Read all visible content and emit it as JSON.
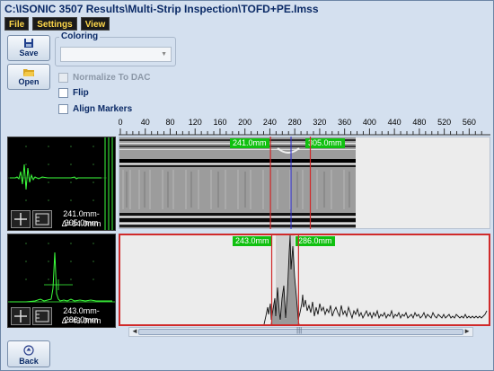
{
  "window": {
    "title": "C:\\ISONIC 3507 Results\\Multi-Strip Inspection\\TOFD+PE.Imss"
  },
  "menu": {
    "items": [
      {
        "label": "File"
      },
      {
        "label": "Settings"
      },
      {
        "label": "View"
      }
    ]
  },
  "sidebar": {
    "save_label": "Save",
    "open_label": "Open",
    "back_label": "Back"
  },
  "coloring": {
    "legend": "Coloring",
    "selected": ""
  },
  "options": {
    "normalize_label": "Normalize To DAC",
    "normalize_enabled": false,
    "normalize_checked": false,
    "flip_label": "Flip",
    "flip_checked": false,
    "align_label": "Align Markers",
    "align_checked": false
  },
  "ruler": {
    "ticks": [
      "0",
      "40",
      "80",
      "120",
      "160",
      "200",
      "240",
      "280",
      "320",
      "360",
      "400",
      "440",
      "480",
      "520",
      "560"
    ],
    "max": 580
  },
  "tofd_panel": {
    "readout_range": "241.0mm-305.0mm",
    "readout_delta": "Δ=64.0mm",
    "marker_left": "241.0mm",
    "marker_right": "305.0mm",
    "marker_left_value": 241,
    "marker_right_value": 305,
    "cursor_value": 274
  },
  "pe_panel": {
    "readout_range": "243.0mm-286.0mm",
    "readout_delta": "Δ=43.0mm",
    "marker_left": "243.0mm",
    "marker_right": "286.0mm",
    "marker_left_value": 243,
    "marker_right_value": 286
  },
  "colors": {
    "marker_green": "#10c010",
    "gate_red": "#d02a2a",
    "cursor_blue": "#2a2ad0",
    "scope_trace": "#3cff3c",
    "window_bg": "#d4e0ef"
  }
}
